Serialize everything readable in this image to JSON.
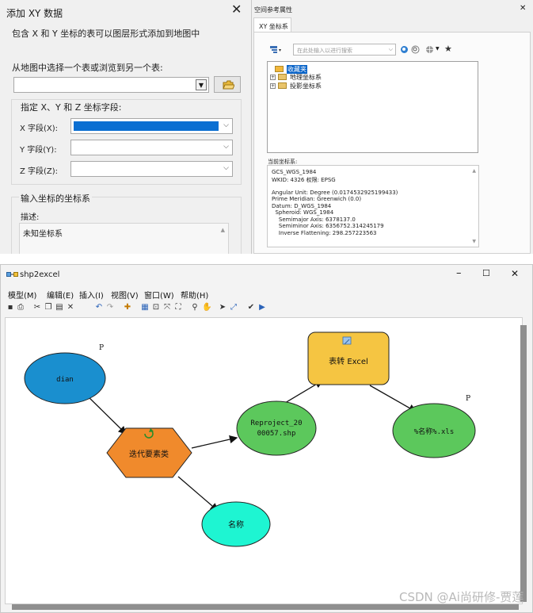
{
  "add_xy_dialog": {
    "title": "添加 XY 数据",
    "close_glyph": "✕",
    "description": "包含 X 和 Y 坐标的表可以图层形式添加到地图中",
    "choose_table_label": "从地图中选择一个表或浏览到另一个表:",
    "table_value": "",
    "fields_group_label": "指定 X、Y 和 Z 坐标字段:",
    "x_label": "X 字段(X):",
    "y_label": "Y 字段(Y):",
    "z_label": "Z 字段(Z):",
    "x_value": "",
    "y_value": "",
    "z_value": "",
    "coord_group_label": "输入坐标的坐标系",
    "desc_label": "描述:",
    "desc_value": "未知坐标系"
  },
  "spatial_reference": {
    "title": "空间参考属性",
    "close_glyph": "✕",
    "tab": "XY 坐标系",
    "search_placeholder": "在此处输入以进行搜索",
    "tree": [
      {
        "label": "收藏夹",
        "selected": true
      },
      {
        "label": "地理坐标系",
        "selected": false
      },
      {
        "label": "投影坐标系",
        "selected": false
      }
    ],
    "current_label": "当前坐标系:",
    "current_info": [
      "GCS_WGS_1984",
      "WKID: 4326 权限: EPSG",
      "",
      "Angular Unit: Degree (0.0174532925199433)",
      "Prime Meridian: Greenwich (0.0)",
      "Datum: D_WGS_1984",
      "  Spheroid: WGS_1984",
      "    Semimajor Axis: 6378137.0",
      "    Semiminor Axis: 6356752.314245179",
      "    Inverse Flattening: 298.257223563"
    ]
  },
  "model_window": {
    "title": "shp2excel",
    "controls": {
      "minimize": "–",
      "maximize": "☐",
      "close": "✕"
    },
    "menu": [
      "模型(M)",
      "编辑(E)",
      "插入(I)",
      "视图(V)",
      "窗口(W)",
      "帮助(H)"
    ],
    "toolbar_icons": [
      "save-icon",
      "print-icon",
      "cut-icon",
      "copy-icon",
      "paste-icon",
      "delete-icon",
      "undo-icon",
      "redo-icon",
      "add-data-icon",
      "auto-layout-icon",
      "full-extent-icon",
      "fit-icon",
      "zoom-fixed-icon",
      "zoom-in-icon",
      "pan-icon",
      "select-icon",
      "connect-icon",
      "validate-icon",
      "run-icon"
    ],
    "nodes": {
      "dian": "dian",
      "iterate": "迭代要素类",
      "name": "名称",
      "reproject_line1": "Reproject_20",
      "reproject_line2": "00057.shp",
      "to_excel": "表转 Excel",
      "output": "%名称%.xls",
      "p1": "P",
      "p2": "P"
    },
    "colors": {
      "input": "#1a8fcf",
      "iterator": "#f08a2c",
      "name": "#1ef5d2",
      "derived": "#5cc85c",
      "tool": "#f5c542"
    }
  },
  "watermark": "CSDN @Ai尚研修-贾莲"
}
